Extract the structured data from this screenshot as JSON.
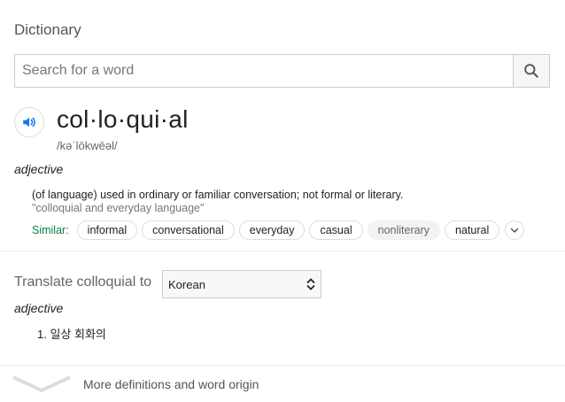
{
  "header": {
    "title": "Dictionary"
  },
  "search": {
    "placeholder": "Search for a word",
    "value": ""
  },
  "entry": {
    "word": "col·lo·qui·al",
    "phonetic": "/kəˈlōkwēəl/",
    "part_of_speech": "adjective",
    "definition": "(of language) used in ordinary or familiar conversation; not formal or literary.",
    "example": "\"colloquial and everyday language\"",
    "similar_label": "Similar:",
    "similar": [
      "informal",
      "conversational",
      "everyday",
      "casual",
      "nonliterary",
      "natural"
    ]
  },
  "translate": {
    "label": "Translate colloquial to",
    "language": "Korean",
    "part_of_speech": "adjective",
    "items": [
      "1. 일상 회화의"
    ]
  },
  "footer": {
    "link": "More definitions and word origin"
  },
  "icons": {
    "search": "search-icon",
    "speaker": "speaker-icon",
    "expand": "chevron-down-icon",
    "footer": "chevron-down-icon"
  },
  "colors": {
    "similar_label": "#0b8043",
    "speaker": "#1a73e8"
  }
}
